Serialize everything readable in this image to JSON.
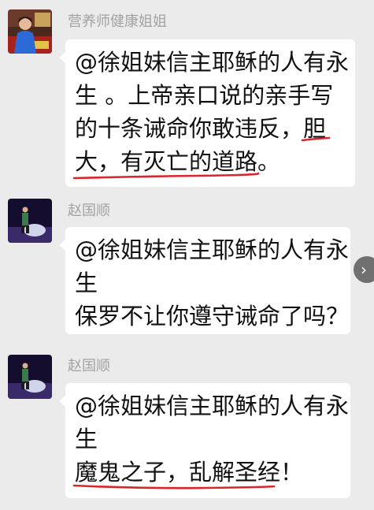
{
  "messages": [
    {
      "sender": "营养师健康姐姐",
      "lines": [
        "@徐姐妹信主耶稣的人有永",
        "生 。上帝亲口说的亲手写",
        "的十条诫命你敢违反，胆",
        "大，有灭亡的道路。"
      ]
    },
    {
      "sender": "赵国顺",
      "lines": [
        "@徐姐妹信主耶稣的人有永",
        "生",
        "保罗不让你遵守诫命了吗？"
      ]
    },
    {
      "sender": "赵国顺",
      "lines": [
        "@徐姐妹信主耶稣的人有永",
        "生",
        "魔鬼之子，乱解圣经！"
      ]
    }
  ],
  "scroll_arrow": "›",
  "colors": {
    "background": "#ebebeb",
    "bubble": "#ffffff",
    "sender": "#a3a3a3",
    "text": "#111111",
    "underline": "#d9262d"
  },
  "icons": {
    "avatar_1": "user-avatar-photo",
    "avatar_2": "user-avatar-photo",
    "scroll_arrow": "chevron-right-icon"
  }
}
